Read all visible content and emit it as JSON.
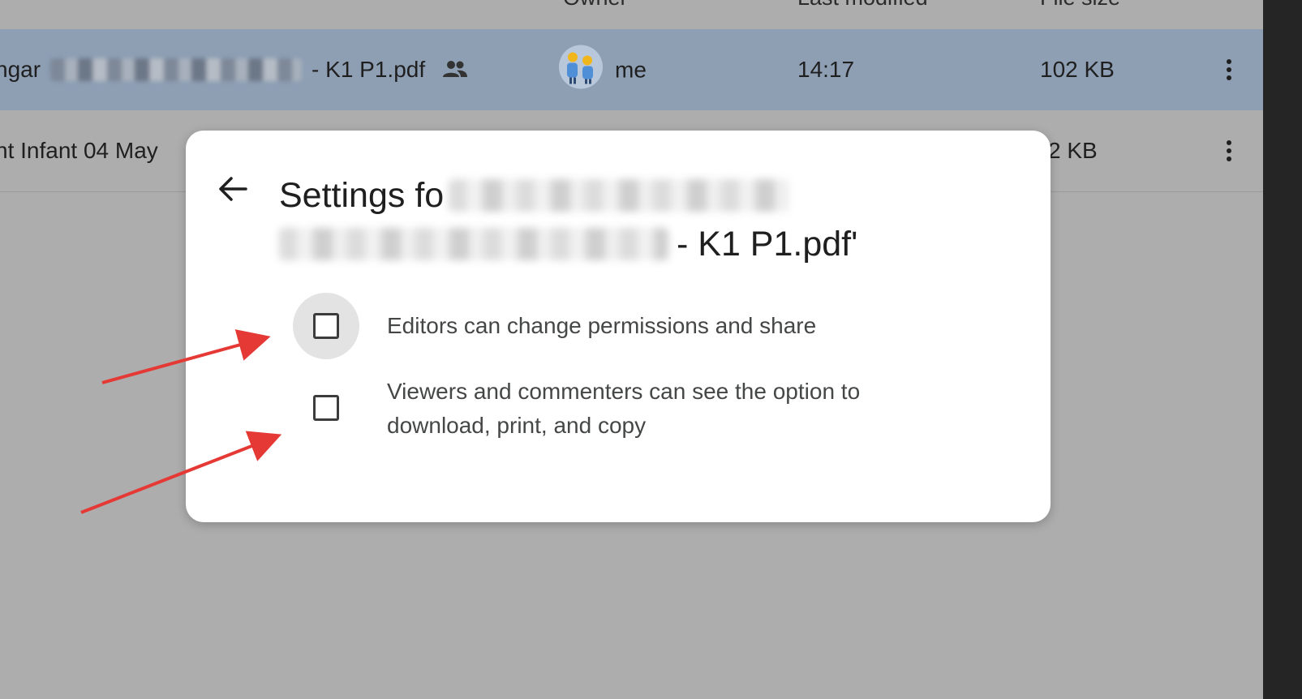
{
  "header": {
    "owner": "Owner",
    "last_modified": "Last modified",
    "file_size": "File size"
  },
  "rows": [
    {
      "name_prefix": "ngar",
      "name_suffix": "- K1 P1.pdf",
      "owner": "me",
      "last_modified": "14:17",
      "file_size": "102 KB",
      "selected": true
    },
    {
      "name_prefix": "nt Infant 04 May",
      "file_size": "2 KB",
      "selected": false
    }
  ],
  "dialog": {
    "title_prefix": "Settings fo",
    "title_suffix": "- K1 P1.pdf'",
    "options": [
      {
        "label": "Editors can change permissions and share",
        "checked": false
      },
      {
        "label": "Viewers and commenters can see the option to download, print, and copy",
        "checked": false
      }
    ]
  },
  "icons": {
    "back": "arrow-left-icon",
    "shared": "people-icon",
    "owner_avatar": "avatar",
    "more": "more-vertical-icon",
    "checkbox": "checkbox-icon",
    "annotation": "annotation-arrow"
  },
  "colors": {
    "selected_row": "#8e9fb4",
    "backdrop": "#adadad",
    "dialog_bg": "#ffffff",
    "annotation_arrow": "#e53935"
  }
}
